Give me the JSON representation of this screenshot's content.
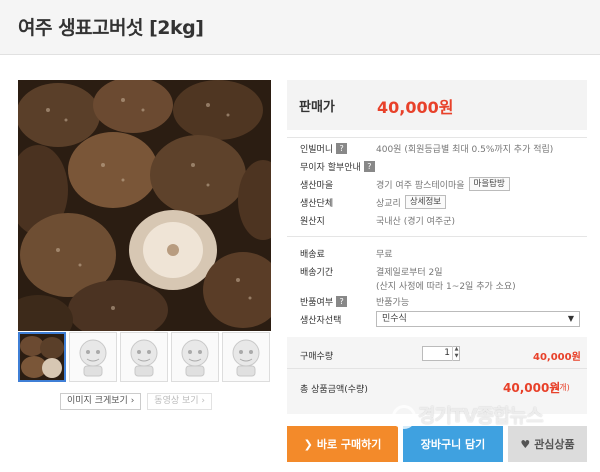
{
  "product": {
    "title": "여주 생표고버섯 [2kg]"
  },
  "price": {
    "label": "판매가",
    "value": "40,000원"
  },
  "info_rows": [
    {
      "label": "인빌머니",
      "help": "?",
      "value": "400원 (회원등급별 최대 0.5%까지 추가 적립)"
    },
    {
      "label": "무이자 할부안내",
      "help": "?",
      "value": ""
    },
    {
      "label": "생산마을",
      "value": "경기 여주 팜스테이마을",
      "button": "마을탐방"
    },
    {
      "label": "생산단체",
      "value": "상교리",
      "button": "상세정보"
    },
    {
      "label": "원산지",
      "value": "국내산 (경기 여주군)"
    },
    {
      "label": "배송료",
      "value": "무료"
    },
    {
      "label": "배송기간",
      "value": "결제일로부터 2일",
      "note": "(산지 사정에 따라 1~2일 추가 소요)"
    },
    {
      "label": "반품여부",
      "help": "?",
      "value": "반품가능"
    },
    {
      "label": "생산자선택",
      "select": "민수식"
    }
  ],
  "quantity": {
    "label": "구매수량",
    "value": "1",
    "price": "40,000원"
  },
  "total": {
    "label": "총 상품금액(수량)",
    "value": "40,000원",
    "count": "(1개)"
  },
  "image_buttons": {
    "enlarge": "이미지 크게보기",
    "video": "동영상 보기"
  },
  "actions": {
    "buy": "바로 구매하기",
    "cart": "장바구니 담기",
    "wish": "관심상품"
  },
  "watermark": "경기TV종합뉴스",
  "icons": {
    "buy": "chevron-right-icon",
    "wish": "heart-icon"
  },
  "colors": {
    "accent_price": "#e8412a",
    "buy_button": "#f38a2a",
    "cart_button": "#3fa1e0",
    "active_thumb_border": "#3f7fd6"
  }
}
